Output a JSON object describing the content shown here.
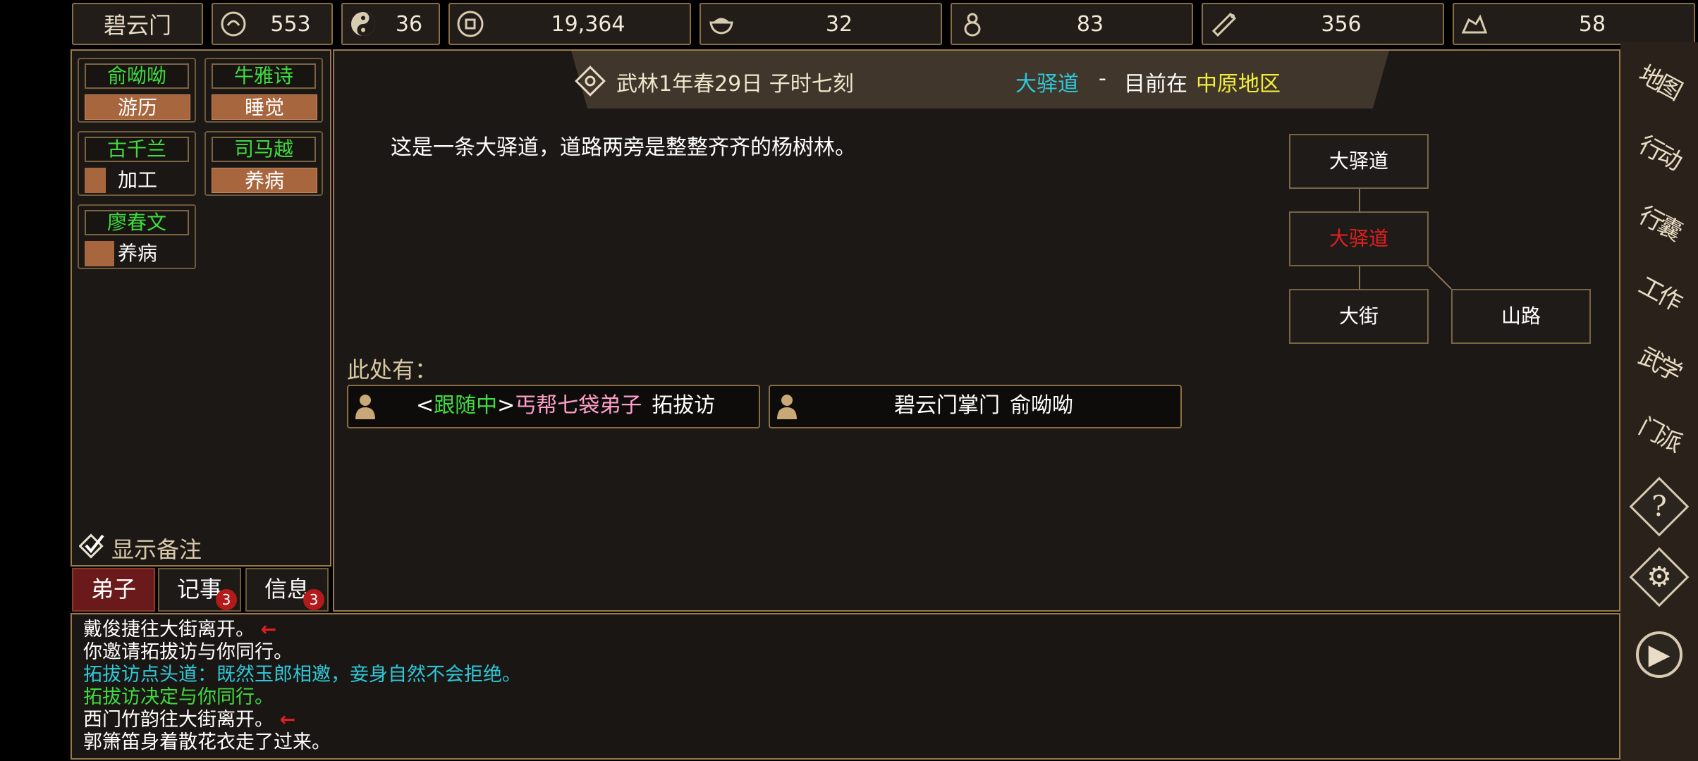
{
  "resources": {
    "sect_name": "碧云门",
    "fame": "553",
    "yinyang": "36",
    "money": "19,364",
    "food": "32",
    "herb": "83",
    "wood": "356",
    "ore": "58"
  },
  "disciples": [
    {
      "name": "俞呦呦",
      "status": "游历"
    },
    {
      "name": "牛雅诗",
      "status": "睡觉"
    },
    {
      "name": "古千兰",
      "status": "加工"
    },
    {
      "name": "司马越",
      "status": "养病"
    },
    {
      "name": "廖春文",
      "status": "养病"
    }
  ],
  "left_panel": {
    "show_notes_label": "显示备注"
  },
  "tabs": [
    {
      "label": "弟子",
      "badge": ""
    },
    {
      "label": "记事",
      "badge": "3"
    },
    {
      "label": "信息",
      "badge": "3"
    }
  ],
  "header": {
    "time": "武林1年春29日 子时七刻",
    "place": "大驿道",
    "separator": "-",
    "location_prefix": "目前在",
    "region": "中原地区"
  },
  "scene": {
    "description": "这是一条大驿道，道路两旁是整整齐齐的杨树林。",
    "here_label": "此处有："
  },
  "npcs": [
    {
      "bracket_open": "<",
      "tag": "跟随中",
      "bracket_close": ">",
      "title": "丐帮七袋弟子",
      "name": "拓拔访"
    },
    {
      "title": "碧云门掌门",
      "name": "俞呦呦"
    }
  ],
  "map": {
    "north": "大驿道",
    "current": "大驿道",
    "south": "大街",
    "southeast": "山路"
  },
  "log": [
    {
      "text": "戴俊捷往大街离开。",
      "color": "#ffffff",
      "arrow": "←"
    },
    {
      "text": "你邀请拓拔访与你同行。",
      "color": "#ffffff",
      "arrow": ""
    },
    {
      "text": "拓拔访点头道：既然玉郎相邀，妾身自然不会拒绝。",
      "color": "#2fc8d8",
      "arrow": ""
    },
    {
      "text": "拓拔访决定与你同行。",
      "color": "#3fdc3f",
      "arrow": ""
    },
    {
      "text": "西门竹韵往大街离开。",
      "color": "#ffffff",
      "arrow": "←"
    },
    {
      "text": "郭箫笛身着散花衣走了过来。",
      "color": "#ffffff",
      "arrow": ""
    }
  ],
  "right_menu": [
    {
      "label": "地图"
    },
    {
      "label": "行动"
    },
    {
      "label": "行囊"
    },
    {
      "label": "工作"
    },
    {
      "label": "武学"
    },
    {
      "label": "门派"
    },
    {
      "label": "?"
    },
    {
      "label": "⚙"
    },
    {
      "label": "▶"
    }
  ],
  "colors": {
    "green": "#3fdc3f",
    "cyan": "#2fc8d8",
    "yellow": "#f2ee3a",
    "red_node": "#e02020",
    "pink": "#ff9ec8",
    "status_fill": "#a8663e"
  },
  "disciple_progress": {
    "古千兰": 0.2,
    "廖春文": 0.28
  }
}
